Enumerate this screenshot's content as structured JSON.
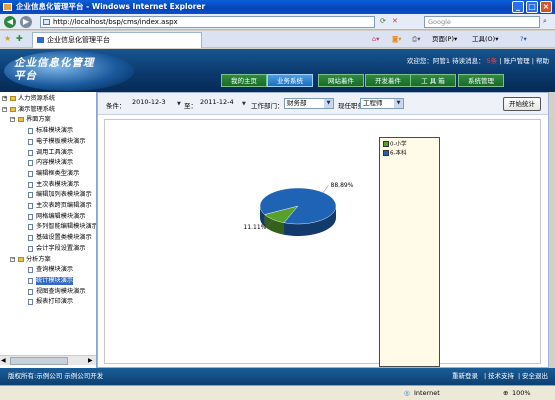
{
  "window": {
    "title": "企业信息化管理平台 - Windows Internet Explorer"
  },
  "browser": {
    "address": "http://localhost/bsp/cms/index.aspx",
    "search_placeholder": "Google",
    "tab_title": "企业信息化管理平台",
    "tools": {
      "page": "页面(P)",
      "tools": "工具(O)"
    }
  },
  "header": {
    "logo_text": "企业信息化管理平台",
    "welcome": "欢迎您：阿管1 待读消息：",
    "unread": "5条",
    "account_link": "账户管理",
    "help_link": "帮助",
    "nav_tabs": [
      "我的主页",
      "业务系统",
      "网站着件",
      "开发着件",
      "工 具 箱",
      "系统管理"
    ],
    "active_tab": 1
  },
  "sidebar": {
    "items": [
      {
        "label": "人力资源系统",
        "level": 0,
        "kind": "root"
      },
      {
        "label": "演示管理系统",
        "level": 0,
        "kind": "root"
      },
      {
        "label": "界面方案",
        "level": 1,
        "kind": "folder"
      },
      {
        "label": "标准模块演示",
        "level": 2,
        "kind": "doc"
      },
      {
        "label": "电子模板模块演示",
        "level": 2,
        "kind": "doc"
      },
      {
        "label": "调用工具演示",
        "level": 2,
        "kind": "doc"
      },
      {
        "label": "内容模块演示",
        "level": 2,
        "kind": "doc"
      },
      {
        "label": "编辑框类型演示",
        "level": 2,
        "kind": "doc"
      },
      {
        "label": "主次表模块演示",
        "level": 2,
        "kind": "doc"
      },
      {
        "label": "编辑加列表模块演示",
        "level": 2,
        "kind": "doc"
      },
      {
        "label": "主次表跨页编辑演示",
        "level": 2,
        "kind": "doc"
      },
      {
        "label": "网格编辑模块演示",
        "level": 2,
        "kind": "doc"
      },
      {
        "label": "多列智能编辑模块演示",
        "level": 2,
        "kind": "doc"
      },
      {
        "label": "基础设置类模块演示",
        "level": 2,
        "kind": "doc"
      },
      {
        "label": "会计字段设置演示",
        "level": 2,
        "kind": "doc"
      },
      {
        "label": "分析方案",
        "level": 1,
        "kind": "folder"
      },
      {
        "label": "查询模块演示",
        "level": 2,
        "kind": "doc"
      },
      {
        "label": "统计模块演示",
        "level": 2,
        "kind": "doc",
        "selected": true
      },
      {
        "label": "视图查询模块演示",
        "level": 2,
        "kind": "doc"
      },
      {
        "label": "报表打印演示",
        "level": 2,
        "kind": "doc"
      }
    ]
  },
  "filters": {
    "cond_label": "条件：",
    "date_from": "2010-12-3",
    "to_label": "至：",
    "date_to": "2011-12-4",
    "dept_label": "工作部门：",
    "dept_value": "财务部",
    "job_label": "现任职务：",
    "job_value": "工程师",
    "stat_button": "开始统计"
  },
  "chart_data": {
    "type": "pie",
    "slices": [
      {
        "name": "0-小学",
        "value": 11.11,
        "label": "11.11%",
        "color": "#57a02c"
      },
      {
        "name": "6-本科",
        "value": 88.89,
        "label": "88.89%",
        "color": "#1f63b4"
      }
    ],
    "legend_position": "right"
  },
  "footer": {
    "left": "版权所有:示例公司 示例公司开发",
    "links": [
      "重新登录",
      "技术支持",
      "安全退出"
    ]
  },
  "statusbar": {
    "zone": "Internet",
    "zoom": "100%"
  }
}
